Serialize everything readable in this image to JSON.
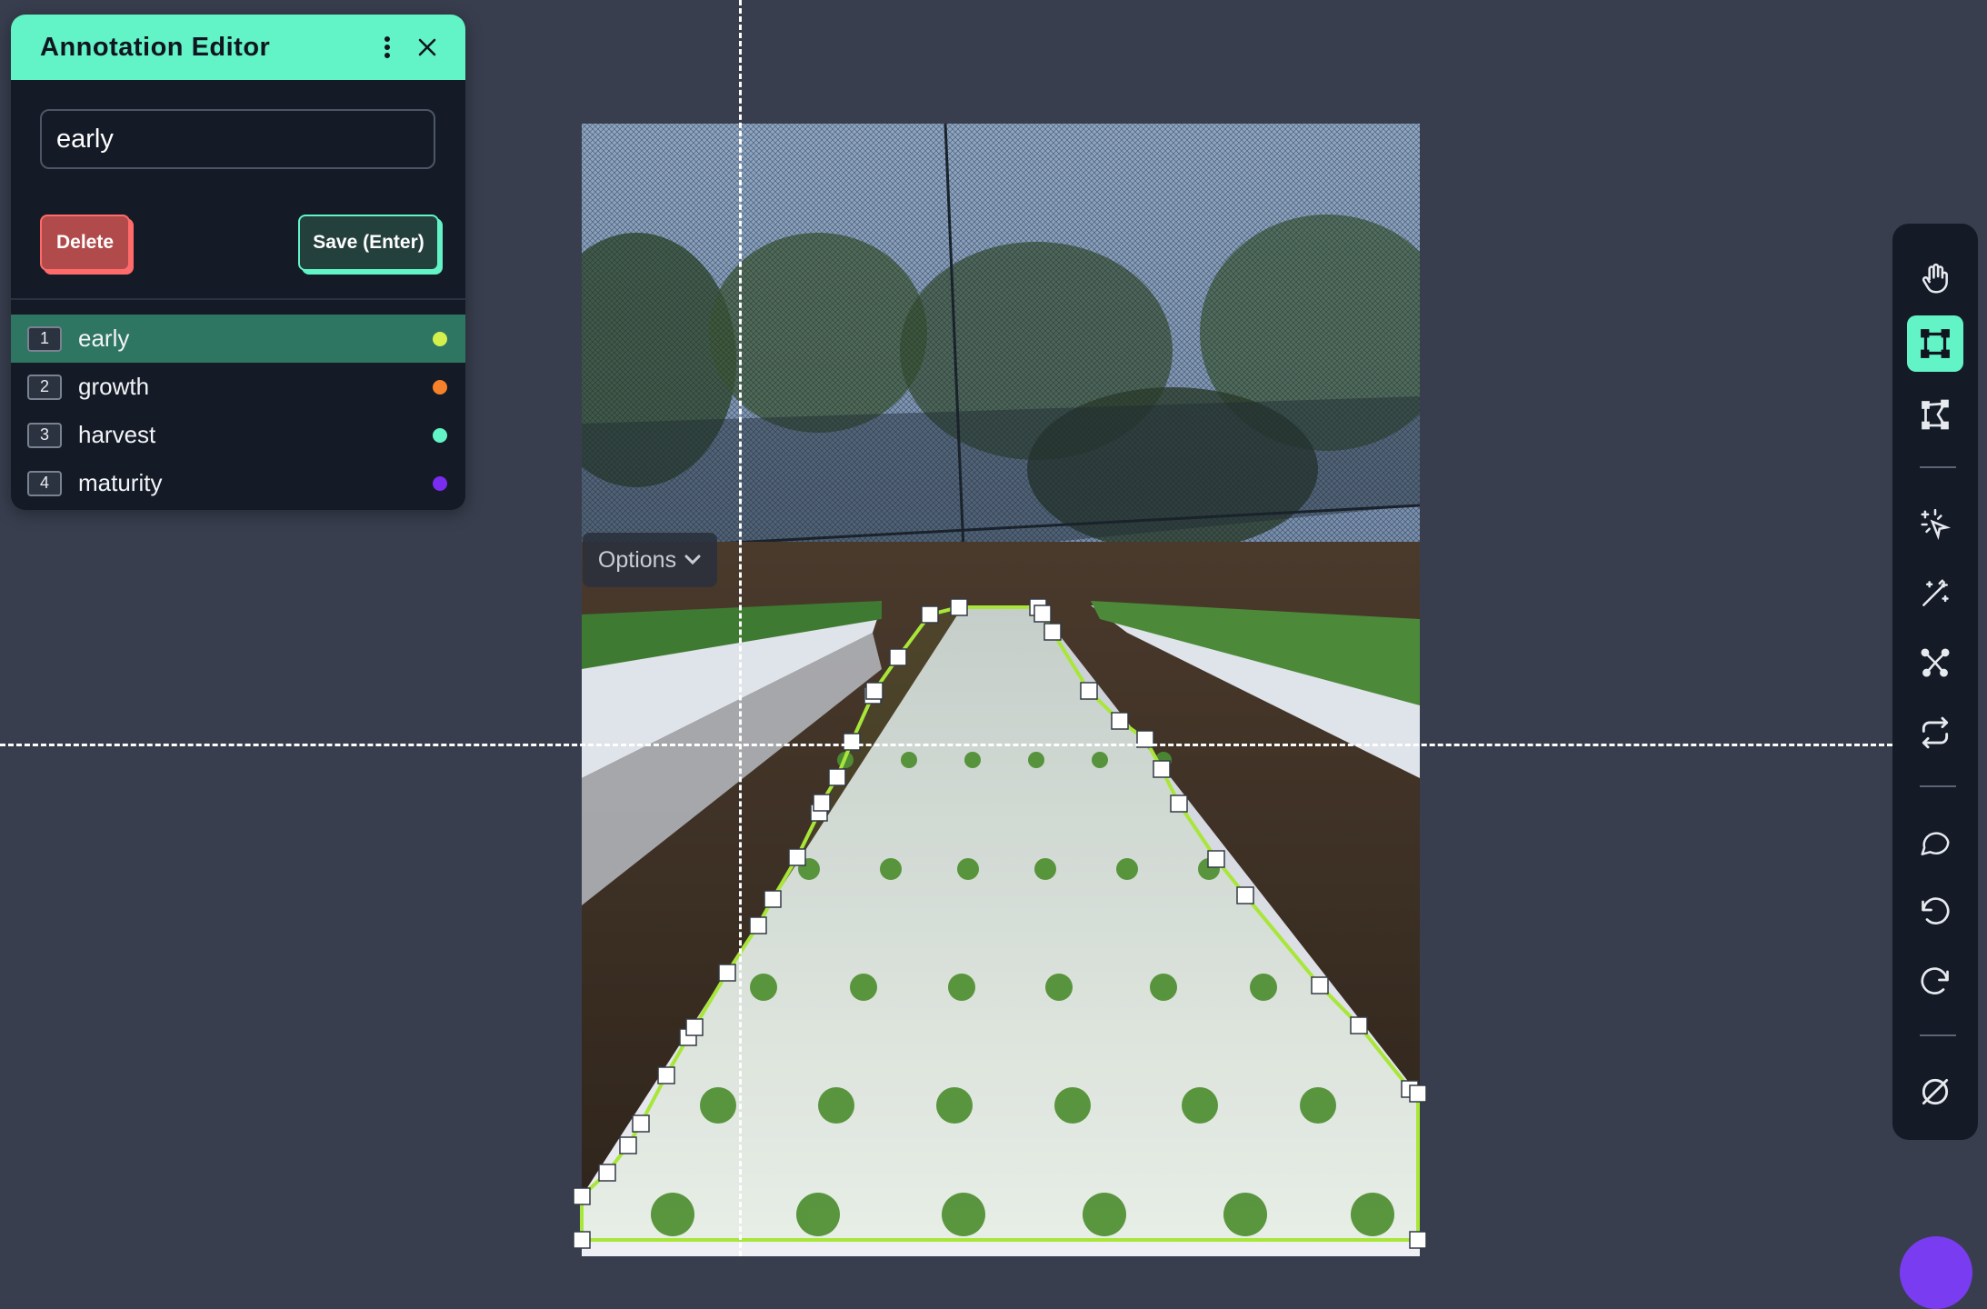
{
  "editor": {
    "title": "Annotation Editor",
    "input_value": "early",
    "delete_label": "Delete",
    "save_label": "Save (Enter)",
    "labels": [
      {
        "key": "1",
        "name": "early",
        "color": "#d4f04c",
        "selected": true
      },
      {
        "key": "2",
        "name": "growth",
        "color": "#f5822a",
        "selected": false
      },
      {
        "key": "3",
        "name": "harvest",
        "color": "#62f4c7",
        "selected": false
      },
      {
        "key": "4",
        "name": "maturity",
        "color": "#7a2cf0",
        "selected": false
      }
    ]
  },
  "canvas": {
    "options_label": "Options",
    "polygon_color": "#a8e63a"
  },
  "toolbar": {
    "tools": [
      "hand-icon",
      "bounding-box-icon",
      "polygon-icon",
      "smart-select-icon",
      "magic-wand-icon",
      "keypoints-icon",
      "convert-icon",
      "comment-icon",
      "undo-icon",
      "redo-icon",
      "hide-annotations-icon"
    ],
    "active_tool": "bounding-box-icon"
  }
}
